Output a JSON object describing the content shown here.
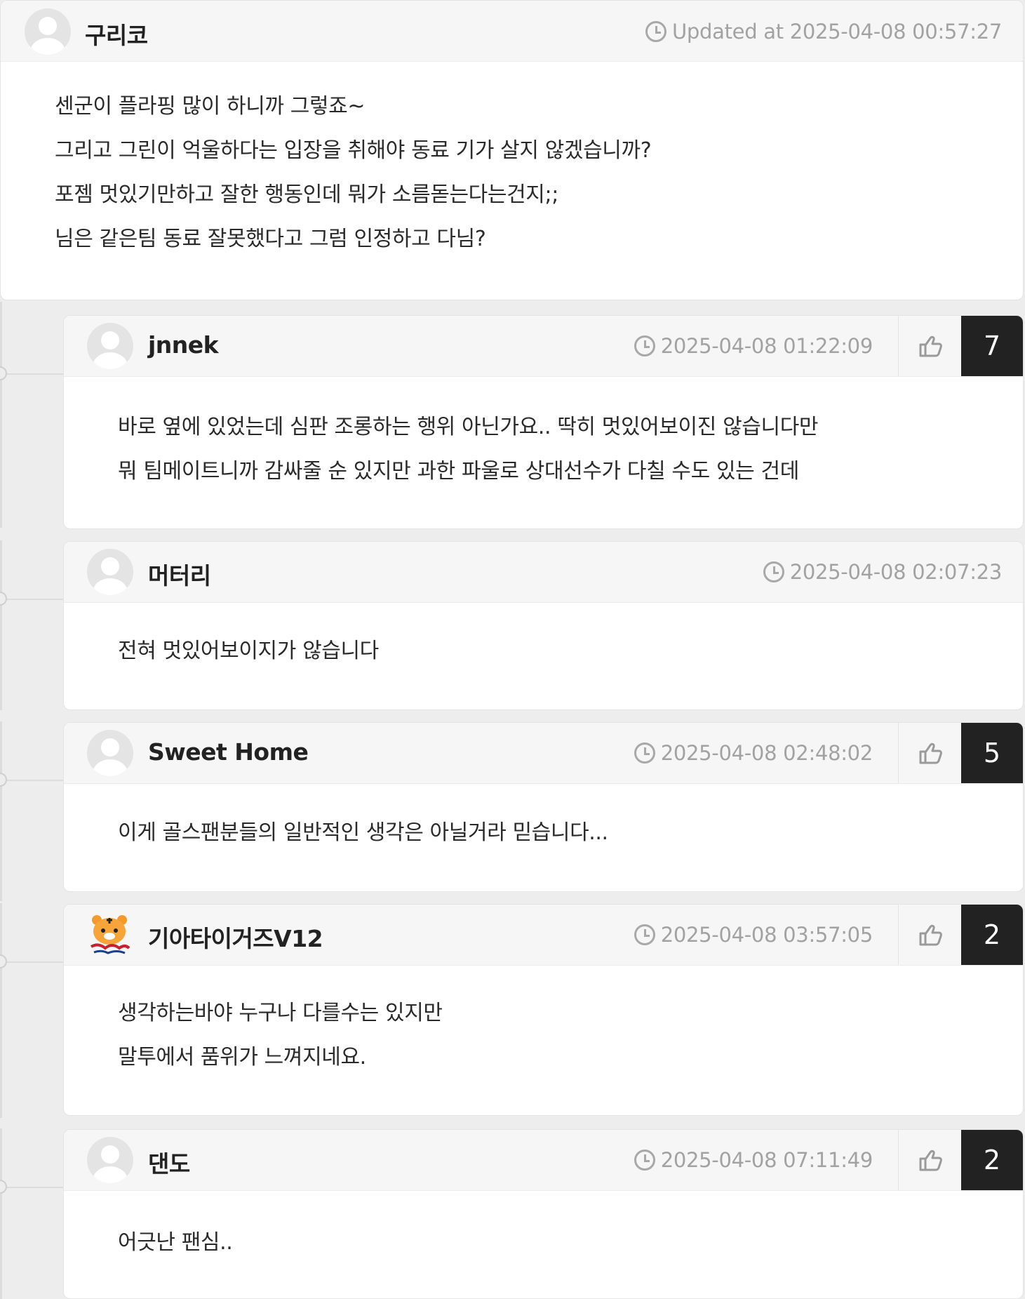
{
  "parent": {
    "author": "구리코",
    "updated": "Updated at 2025-04-08 00:57:27",
    "lines": [
      "센군이 플라핑 많이 하니까 그렇죠~",
      "그리고 그린이 억울하다는 입장을 취해야 동료 기가 살지 않겠습니까?",
      "포젬 멋있기만하고 잘한 행동인데 뭐가 소름돋는다는건지;;",
      "님은 같은팀 동료 잘못했다고 그럼 인정하고 다님?"
    ]
  },
  "replies": [
    {
      "author": "jnnek",
      "time": "2025-04-08 01:22:09",
      "likes": "7",
      "lines": [
        "바로 옆에 있었는데 심판 조롱하는 행위 아닌가요.. 딱히 멋있어보이진 않습니다만",
        "뭐 팀메이트니까 감싸줄 순 있지만 과한 파울로 상대선수가 다칠 수도 있는 건데"
      ]
    },
    {
      "author": "머터리",
      "time": "2025-04-08 02:07:23",
      "lines": [
        "전혀 멋있어보이지가 않습니다"
      ]
    },
    {
      "author": "Sweet Home",
      "time": "2025-04-08 02:48:02",
      "likes": "5",
      "lines": [
        "이게 골스팬분들의 일반적인 생각은 아닐거라 믿습니다..."
      ]
    },
    {
      "author": "기아타이거즈V12",
      "time": "2025-04-08 03:57:05",
      "likes": "2",
      "avatar_icon": "tiger-mascot-icon",
      "lines": [
        "생각하는바야 누구나 다를수는 있지만",
        "말투에서 품위가 느껴지네요."
      ]
    },
    {
      "author": "댄도",
      "time": "2025-04-08 07:11:49",
      "likes": "2",
      "lines": [
        "어긋난 팬심.."
      ]
    }
  ],
  "colors": {
    "background": "#ededed",
    "header_bg": "#f6f6f6",
    "like_count_bg": "#222222",
    "timestamp": "#a2a2a2"
  }
}
